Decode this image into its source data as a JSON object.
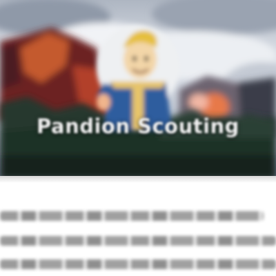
{
  "hero": {
    "title": "Pandion Scouting",
    "image": "vault-boy-mascot-banner"
  },
  "colors": {
    "sky": "#c9d0da",
    "mountain": "#7a2a22",
    "mountain_highlight": "#c9552e",
    "forest": "#20352c",
    "vault_blue": "#2e5a9c",
    "vault_yellow": "#e8c468",
    "title_text": "#f2f2f2"
  },
  "icons": [
    "vault-boy-avatar-icon"
  ]
}
